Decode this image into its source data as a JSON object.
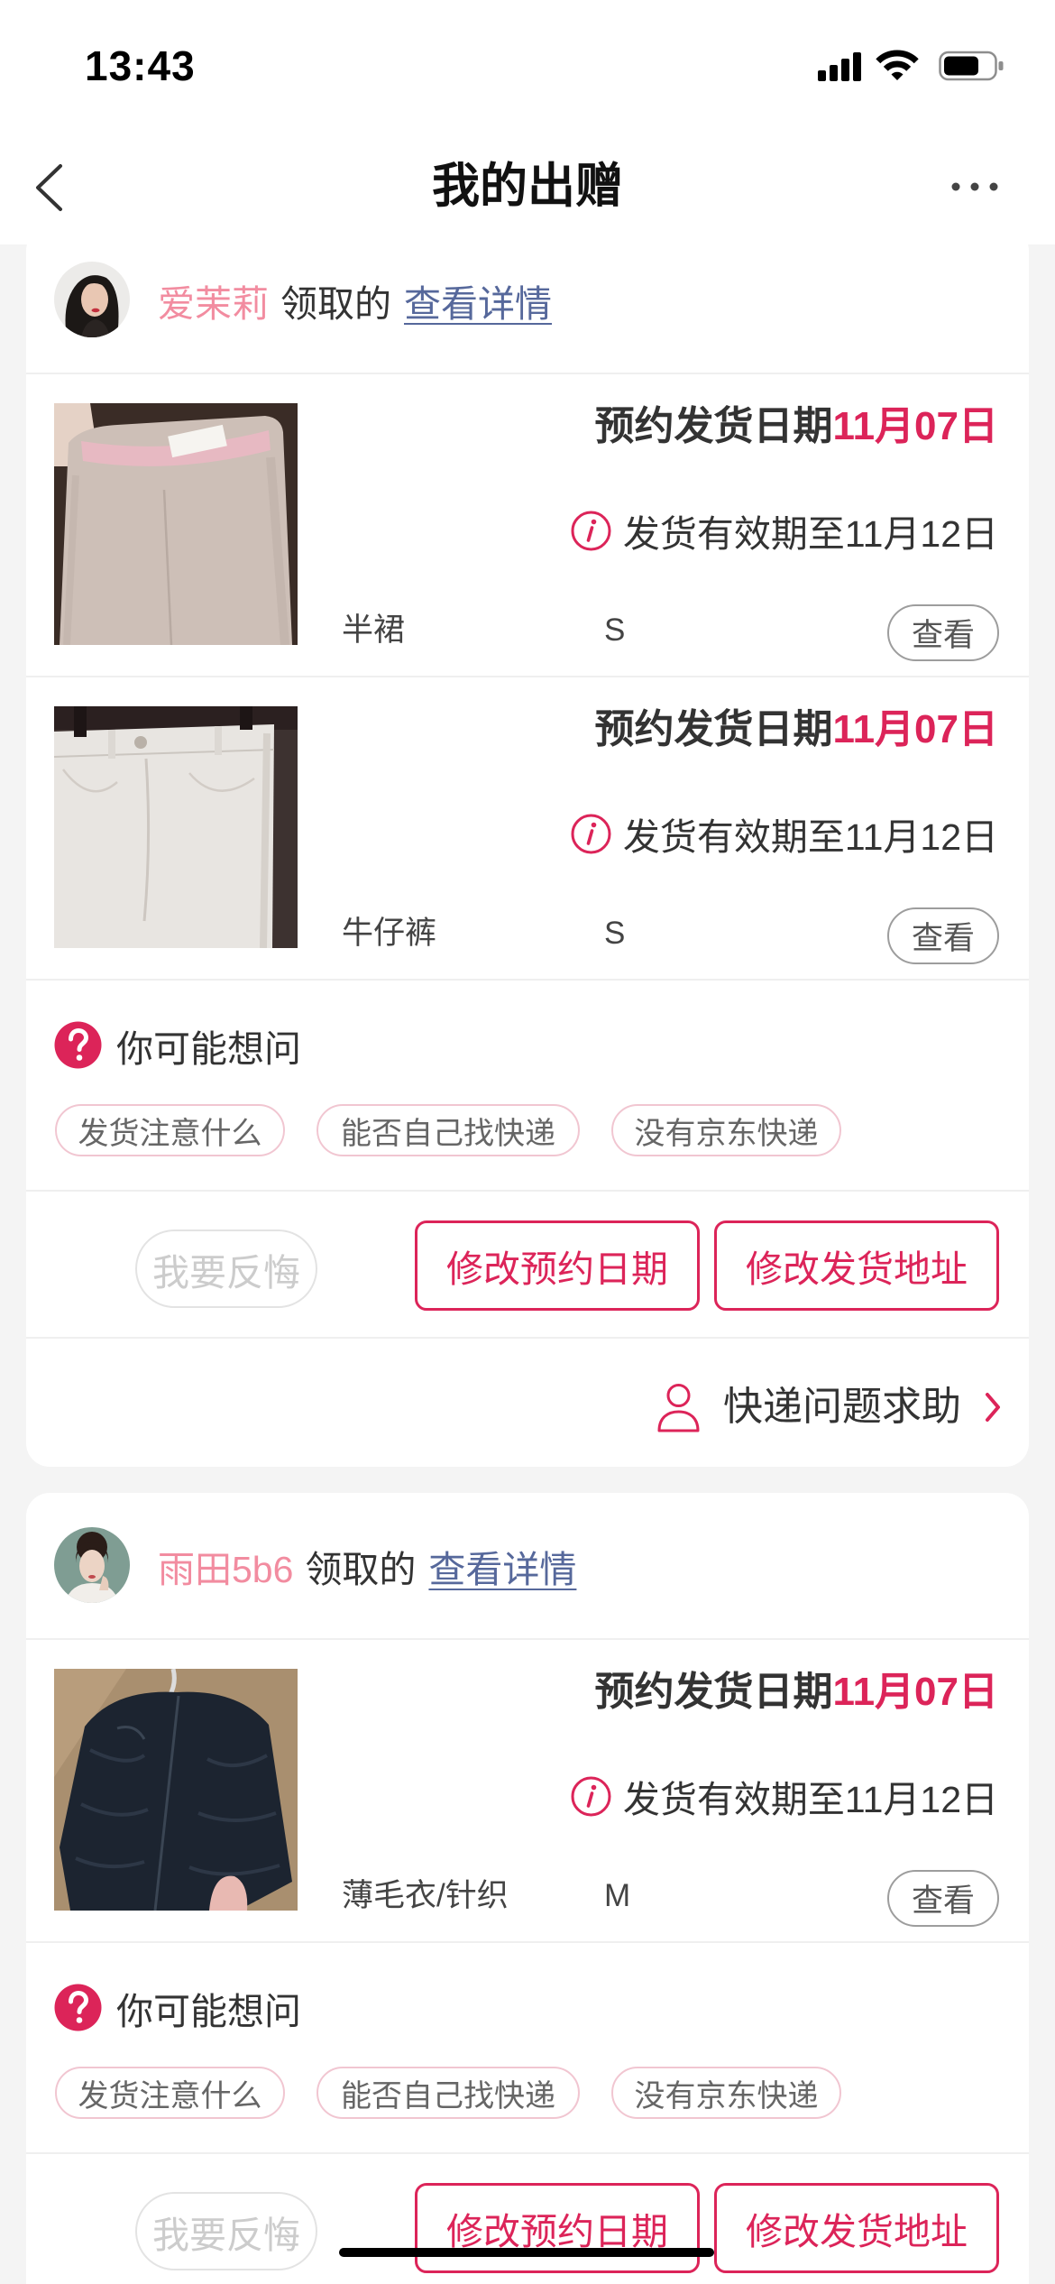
{
  "theme": {
    "accent": "#dc2459",
    "receiver_name_color": "#f28ca0",
    "link_color": "#56689b",
    "page_background": "#f4f4f4"
  },
  "status_bar": {
    "time": "13:43",
    "icons": [
      "signal-icon",
      "wifi-icon",
      "battery-icon"
    ]
  },
  "nav": {
    "title": "我的出赠",
    "back_icon": "chevron-left-icon",
    "more_icon": "more-dots-icon"
  },
  "orders": [
    {
      "receiver_name": "爱茉莉",
      "received_label": "领取的",
      "detail_link": "查看详情",
      "items": [
        {
          "ship_date_label": "预约发货日期",
          "ship_date": "11月07日",
          "valid_until": "发货有效期至11月12日",
          "category": "半裙",
          "size": "S",
          "view_button": "查看"
        },
        {
          "ship_date_label": "预约发货日期",
          "ship_date": "11月07日",
          "valid_until": "发货有效期至11月12日",
          "category": "牛仔裤",
          "size": "S",
          "view_button": "查看"
        }
      ],
      "faq": {
        "title": "你可能想问",
        "tags": [
          "发货注意什么",
          "能否自己找快递",
          "没有京东快递"
        ]
      },
      "actions": {
        "regret": "我要反悔",
        "change_date": "修改预约日期",
        "change_address": "修改发货地址"
      },
      "help": {
        "label": "快递问题求助"
      }
    },
    {
      "receiver_name": "雨田5b6",
      "received_label": "领取的",
      "detail_link": "查看详情",
      "items": [
        {
          "ship_date_label": "预约发货日期",
          "ship_date": "11月07日",
          "valid_until": "发货有效期至11月12日",
          "category": "薄毛衣/针织",
          "size": "M",
          "view_button": "查看"
        }
      ],
      "faq": {
        "title": "你可能想问",
        "tags": [
          "发货注意什么",
          "能否自己找快递",
          "没有京东快递"
        ]
      },
      "actions": {
        "regret": "我要反悔",
        "change_date": "修改预约日期",
        "change_address": "修改发货地址"
      }
    }
  ]
}
